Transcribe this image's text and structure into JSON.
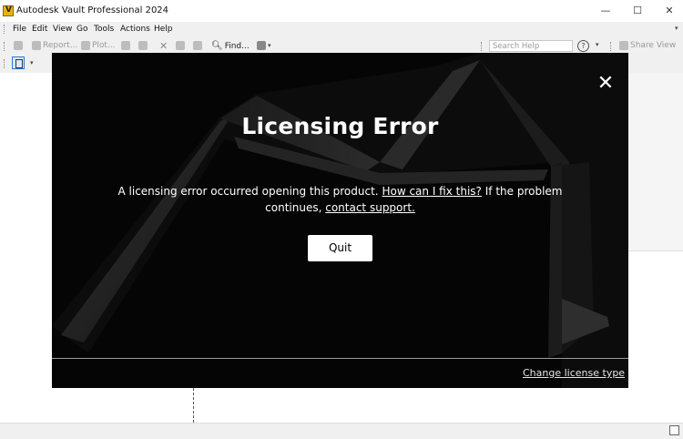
{
  "window": {
    "title": "Autodesk Vault Professional 2024",
    "minimize": "—",
    "maximize": "☐",
    "close": "✕"
  },
  "menu": [
    "File",
    "Edit",
    "View",
    "Go",
    "Tools",
    "Actions",
    "Help"
  ],
  "toolbar": {
    "report_label": "Report...",
    "plot_label": "Plot...",
    "find_label": "Find...",
    "search_placeholder": "Search Help",
    "help_glyph": "?",
    "share_label": "Share View"
  },
  "dialog": {
    "title": "Licensing Error",
    "message_part1": "A licensing error occurred opening this product.",
    "link_fix": "How can I fix this?",
    "message_part2": "If the problem continues,",
    "link_support": "contact support.",
    "quit_label": "Quit",
    "change_license_label": "Change license type",
    "close_glyph": "✕"
  },
  "colors": {
    "dialog_bg": "#050505",
    "accent": "#2a7ad5",
    "app_icon": "#e8b400"
  }
}
